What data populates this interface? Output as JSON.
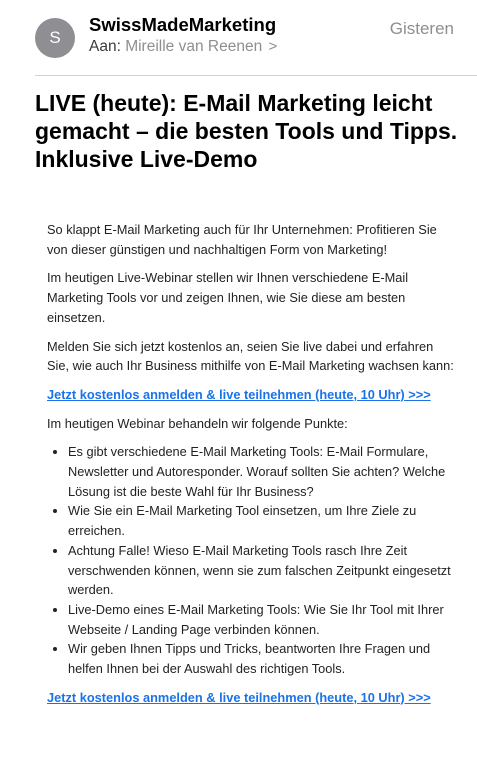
{
  "header": {
    "avatar_initial": "S",
    "sender": "SwissMadeMarketing",
    "date": "Gisteren",
    "to_label": "Aan:",
    "recipient": "Mireille van Reenen",
    "recipient_chevron": ">"
  },
  "subject": "LIVE (heute): E-Mail Marketing leicht gemacht – die besten Tools und Tipps. Inklusive Live-Demo",
  "body": {
    "p1": "So klappt E-Mail Marketing auch für Ihr Unternehmen: Profitieren Sie von dieser günstigen und nachhaltigen Form von Marketing!",
    "p2": "Im heutigen Live-Webinar stellen wir Ihnen verschiedene E-Mail Marketing Tools vor und zeigen Ihnen, wie Sie diese am besten einsetzen.",
    "p3": "Melden Sie sich jetzt kostenlos an, seien Sie live dabei und erfahren Sie, wie auch Ihr Business mithilfe von E-Mail Marketing wachsen kann:",
    "cta1": "Jetzt kostenlos anmelden & live teilnehmen (heute, 10 Uhr) >>>",
    "p4": "Im heutigen Webinar behandeln wir folgende Punkte:",
    "bullets": [
      "Es gibt verschiedene E-Mail Marketing Tools: E-Mail Formulare, Newsletter und Autoresponder. Worauf sollten Sie achten? Welche Lösung ist die beste Wahl für Ihr Business?",
      "Wie Sie ein E-Mail Marketing Tool einsetzen, um Ihre Ziele zu erreichen.",
      "Achtung Falle! Wieso E-Mail Marketing Tools rasch Ihre Zeit verschwenden können, wenn sie zum falschen Zeitpunkt eingesetzt werden.",
      "Live-Demo eines E-Mail Marketing Tools: Wie Sie Ihr Tool mit Ihrer Webseite / Landing Page verbinden können.",
      "Wir geben Ihnen Tipps und Tricks, beantworten Ihre Fragen und helfen Ihnen bei der Auswahl des richtigen Tools."
    ],
    "cta2": "Jetzt kostenlos anmelden & live teilnehmen (heute, 10 Uhr) >>>"
  },
  "colors": {
    "link": "#1a73e8",
    "secondary_text": "#8e8e93",
    "avatar_bg": "#8e8e93"
  }
}
